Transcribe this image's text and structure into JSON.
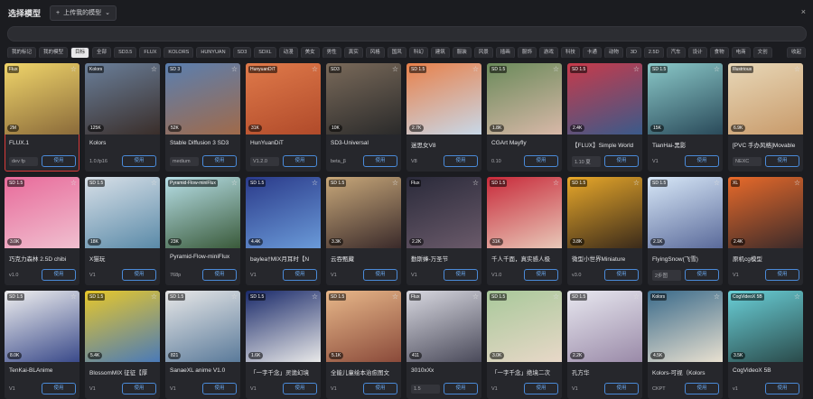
{
  "header": {
    "title": "选择模型",
    "upload_label": "上传我的模型",
    "search_placeholder": ""
  },
  "filters": [
    {
      "label": "我的标记",
      "active": false
    },
    {
      "label": "我的模型",
      "active": false
    },
    {
      "label": "目标",
      "active": true
    },
    {
      "label": "全部",
      "active": false
    },
    {
      "label": "SD3.5",
      "active": false
    },
    {
      "label": "FLUX",
      "active": false
    },
    {
      "label": "KOLORS",
      "active": false
    },
    {
      "label": "HUNYUAN",
      "active": false
    },
    {
      "label": "SD3",
      "active": false
    },
    {
      "label": "SDXL",
      "active": false
    },
    {
      "label": "动漫",
      "active": false
    },
    {
      "label": "美女",
      "active": false
    },
    {
      "label": "男性",
      "active": false
    },
    {
      "label": "真实",
      "active": false
    },
    {
      "label": "风格",
      "active": false
    },
    {
      "label": "国风",
      "active": false
    },
    {
      "label": "科幻",
      "active": false
    },
    {
      "label": "建筑",
      "active": false
    },
    {
      "label": "服装",
      "active": false
    },
    {
      "label": "风景",
      "active": false
    },
    {
      "label": "插画",
      "active": false
    },
    {
      "label": "服饰",
      "active": false
    },
    {
      "label": "游戏",
      "active": false
    },
    {
      "label": "科技",
      "active": false
    },
    {
      "label": "卡通",
      "active": false
    },
    {
      "label": "动物",
      "active": false
    },
    {
      "label": "3D",
      "active": false
    },
    {
      "label": "2.5D",
      "active": false
    },
    {
      "label": "汽车",
      "active": false
    },
    {
      "label": "设计",
      "active": false
    },
    {
      "label": "食物",
      "active": false
    },
    {
      "label": "电商",
      "active": false
    },
    {
      "label": "文创",
      "active": false
    },
    {
      "label": "收起",
      "active": false
    }
  ],
  "use_label": "使用",
  "models": [
    {
      "tag": "Flux",
      "count": "2M",
      "name": "FLUX.1",
      "version": "dev fp",
      "version_box": true,
      "colors": [
        "#f0d56a",
        "#8a6a3a"
      ]
    },
    {
      "tag": "Kolors",
      "count": "125K",
      "name": "Kolors",
      "version": "1.0.fp16",
      "version_box": false,
      "colors": [
        "#6a7f9a",
        "#3a2e2a"
      ]
    },
    {
      "tag": "SD 3",
      "count": "52K",
      "name": "Stable Diffusion 3 SD3",
      "version": "medium",
      "version_box": true,
      "colors": [
        "#5a7fb0",
        "#a06a4a"
      ]
    },
    {
      "tag": "HunyuanDiT",
      "count": "31K",
      "name": "HunYuanDiT",
      "version": "V1.2.0",
      "version_box": true,
      "colors": [
        "#e07a4a",
        "#b04a2a"
      ]
    },
    {
      "tag": "SD3",
      "count": "10K",
      "name": "SD3-Universal",
      "version": "beta_β",
      "version_box": false,
      "colors": [
        "#7a6a5a",
        "#2a2a2a"
      ]
    },
    {
      "tag": "SD 1.5",
      "count": "2.7K",
      "name": "迷思女V8",
      "version": "V8",
      "version_box": false,
      "colors": [
        "#e8804a",
        "#c8d8e8"
      ]
    },
    {
      "tag": "SD 1.5",
      "count": "1.8K",
      "name": "CGArt Mayfly",
      "version": "0.10",
      "version_box": false,
      "colors": [
        "#6a8a5a",
        "#d8b8a8"
      ]
    },
    {
      "tag": "SD 1.5",
      "count": "2.4K",
      "name": "【FLUX】Simple World",
      "version": "1.10 夏",
      "version_box": true,
      "colors": [
        "#c83a4a",
        "#3a5a8a"
      ]
    },
    {
      "tag": "SD 1.5",
      "count": "15K",
      "name": "TianHai-黑影",
      "version": "V1",
      "version_box": false,
      "colors": [
        "#8ac8c8",
        "#2a4a5a"
      ]
    },
    {
      "tag": "Illustrious",
      "count": "6.9K",
      "name": "[PVC 手办风格]Movable",
      "version": "NEXC",
      "version_box": true,
      "colors": [
        "#e8d8b8",
        "#c89a6a"
      ]
    },
    {
      "tag": "SD 1.5",
      "count": "3.0K",
      "name": "巧克力森林 2.5D chibi",
      "version": "v1.0",
      "version_box": false,
      "colors": [
        "#e86a9a",
        "#f0c0d0"
      ]
    },
    {
      "tag": "SD 1.5",
      "count": "18K",
      "name": "X猫玩",
      "version": "V1",
      "version_box": false,
      "colors": [
        "#d8e0e8",
        "#5a8aa8"
      ]
    },
    {
      "tag": "Pyramid-Flow-miniFlux",
      "count": "23K",
      "name": "Pyramid-Flow-miniFlux",
      "version": "768p",
      "version_box": false,
      "colors": [
        "#b8e0e8",
        "#3a5a3a"
      ]
    },
    {
      "tag": "SD 1.5",
      "count": "4.4K",
      "name": "baylea†MIX月耳时【N",
      "version": "V1",
      "version_box": false,
      "colors": [
        "#2a3a8a",
        "#6a9ad8"
      ]
    },
    {
      "tag": "SD 1.5",
      "count": "3.3K",
      "name": "云吞甄藏",
      "version": "V1",
      "version_box": false,
      "colors": [
        "#c8a87a",
        "#3a2a2a"
      ]
    },
    {
      "tag": "Flux",
      "count": "2.2K",
      "name": "勤斯蜂-万圣节",
      "version": "V1",
      "version_box": false,
      "colors": [
        "#2a2a3a",
        "#6a5a6a"
      ]
    },
    {
      "tag": "SD 1.5",
      "count": "31K",
      "name": "千人千面，真实感人极",
      "version": "V1.0",
      "version_box": false,
      "colors": [
        "#c82a3a",
        "#e8c8b8"
      ]
    },
    {
      "tag": "SD 1.5",
      "count": "3.8K",
      "name": "微型小世界Miniature",
      "version": "v3.0",
      "version_box": false,
      "colors": [
        "#e8a82a",
        "#3a2a1a"
      ]
    },
    {
      "tag": "SD 1.5",
      "count": "2.1K",
      "name": "FlyingSnow(飞雪)",
      "version": "2步图",
      "version_box": true,
      "colors": [
        "#d8e8f8",
        "#5a6a9a"
      ]
    },
    {
      "tag": "XL",
      "count": "2.4K",
      "name": "原机cg模型",
      "version": "V1",
      "version_box": false,
      "colors": [
        "#e86a2a",
        "#3a2a2a"
      ]
    },
    {
      "tag": "SD 1.5",
      "count": "8.0K",
      "name": "TenKai-BLAnime",
      "version": "V1",
      "version_box": false,
      "colors": [
        "#f0f0f0",
        "#3a4a8a"
      ]
    },
    {
      "tag": "SD 1.5",
      "count": "5.4K",
      "name": "BlossomMIX 征征【厚",
      "version": "V1",
      "version_box": false,
      "colors": [
        "#e8c82a",
        "#4a7ab8"
      ]
    },
    {
      "tag": "SD 1.5",
      "count": "821",
      "name": "SanaeXL anime V1.0",
      "version": "V1",
      "version_box": false,
      "colors": [
        "#e8e8e8",
        "#5a7a9a"
      ]
    },
    {
      "tag": "SD 1.5",
      "count": "1.6K",
      "name": "「一字千念」灵诡幻境",
      "version": "V1",
      "version_box": false,
      "colors": [
        "#1a2a6a",
        "#e8e8e8"
      ]
    },
    {
      "tag": "SD 1.5",
      "count": "5.1K",
      "name": "全能儿童绘本治愈图文",
      "version": "V1",
      "version_box": false,
      "colors": [
        "#e8b88a",
        "#8a4a3a"
      ]
    },
    {
      "tag": "Flux",
      "count": "411",
      "name": "3010xXx",
      "version": "1.5",
      "version_box": true,
      "colors": [
        "#d8d8e0",
        "#4a4a5a"
      ]
    },
    {
      "tag": "SD 1.5",
      "count": "3.0K",
      "name": "「一字千念」绝境二次",
      "version": "V1",
      "version_box": false,
      "colors": [
        "#a8c89a",
        "#e8d8c8"
      ]
    },
    {
      "tag": "SD 1.5",
      "count": "2.2K",
      "name": "孔方华",
      "version": "V1",
      "version_box": false,
      "colors": [
        "#e8e8f0",
        "#9a8aa8"
      ]
    },
    {
      "tag": "Kolors",
      "count": "4.5K",
      "name": "Kolors-可视（Kolors",
      "version": "CKPT",
      "version_box": false,
      "colors": [
        "#3a6a8a",
        "#e8e0d0"
      ]
    },
    {
      "tag": "CogVideoX 5B",
      "count": "3.5K",
      "name": "CogVideoX 5B",
      "version": "v1",
      "version_box": false,
      "colors": [
        "#6ad0d8",
        "#2a4a4a"
      ]
    }
  ]
}
